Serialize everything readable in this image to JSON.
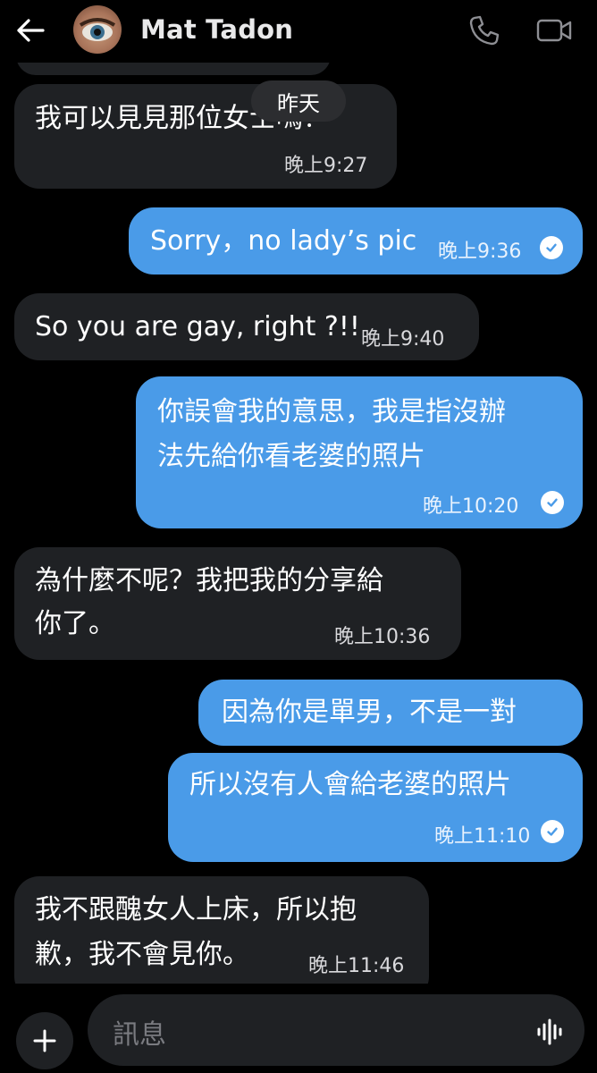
{
  "header": {
    "contact_name": "Mat Tadon",
    "icons": [
      "back-arrow-icon",
      "avatar",
      "phone-icon",
      "video-camera-icon"
    ]
  },
  "date_separator": "昨天",
  "messages": [
    {
      "direction": "incoming",
      "lines": [
        "我可以見見那位女士嗎？"
      ],
      "time": "晚上9:27"
    },
    {
      "direction": "outgoing",
      "lines": [
        "Sorry，no lady’s pic"
      ],
      "time": "晚上9:36",
      "read": true
    },
    {
      "direction": "incoming",
      "lines": [
        "So you are gay, right ?!!"
      ],
      "time": "晚上9:40"
    },
    {
      "direction": "outgoing",
      "lines": [
        "你誤會我的意思，我是指沒辦",
        "法先給你看老婆的照片"
      ],
      "time": "晚上10:20",
      "read": true
    },
    {
      "direction": "incoming",
      "lines": [
        "為什麼不呢？我把我的分享給",
        "你了。"
      ],
      "time": "晚上10:36"
    },
    {
      "direction": "outgoing",
      "lines": [
        "因為你是單男，不是一對"
      ]
    },
    {
      "direction": "outgoing",
      "lines": [
        "所以沒有人會給老婆的照片"
      ],
      "time": "晚上11:10",
      "read": true
    },
    {
      "direction": "incoming",
      "lines": [
        "我不跟醜女人上床，所以抱",
        "歉，我不會見你。"
      ],
      "time": "晚上11:46"
    }
  ],
  "composer": {
    "placeholder": "訊息",
    "icons": [
      "plus-icon",
      "voice-message-icon"
    ]
  },
  "colors": {
    "background": "#000000",
    "incoming_bubble": "#1f2124",
    "outgoing_bubble": "#4a9be8"
  }
}
